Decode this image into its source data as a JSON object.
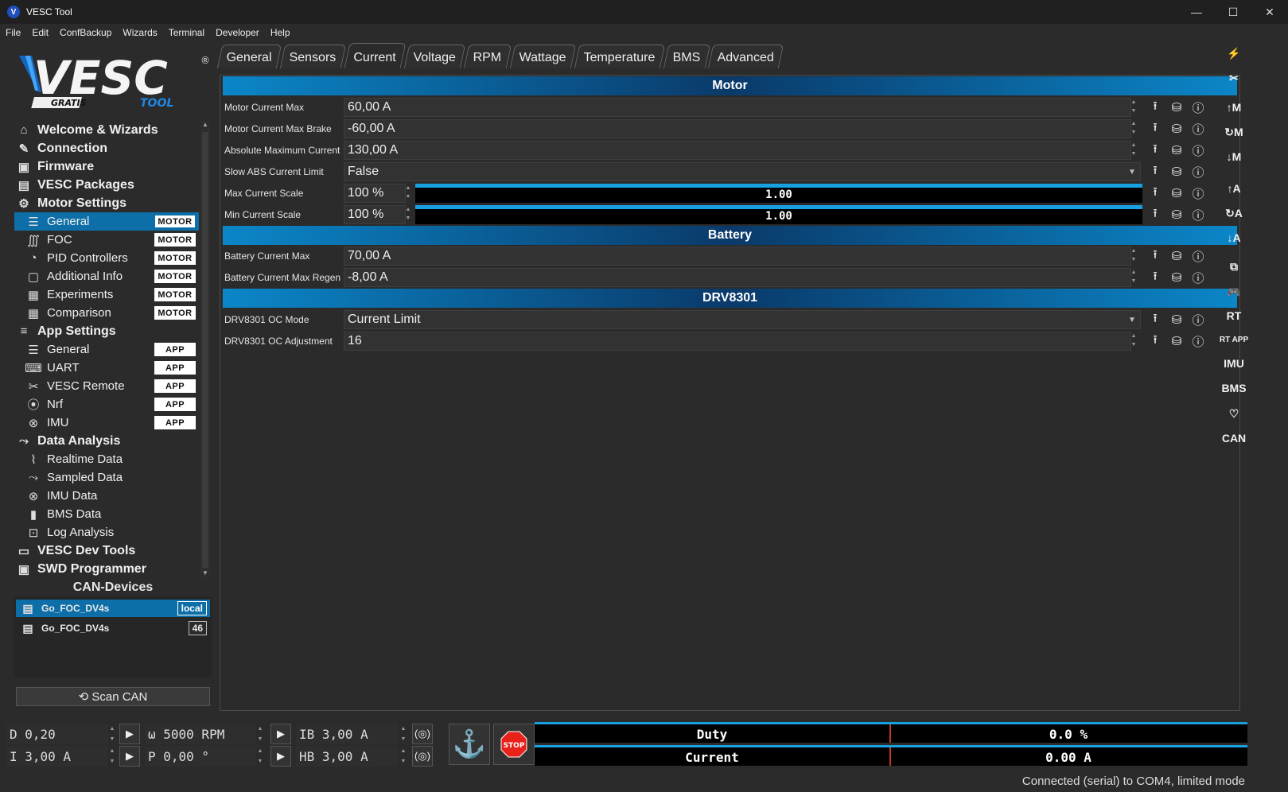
{
  "window": {
    "title": "VESC Tool",
    "controls": [
      "—",
      "☐",
      "✕"
    ]
  },
  "menu": [
    "File",
    "Edit",
    "ConfBackup",
    "Wizards",
    "Terminal",
    "Developer",
    "Help"
  ],
  "logo": {
    "main": "VESC",
    "sub1": "GRATIS",
    "sub2": "TOOL",
    "reg": "®"
  },
  "sidebar": {
    "items": [
      {
        "label": "Welcome & Wizards",
        "icon": "home-icon",
        "glyph": "⌂",
        "top": true
      },
      {
        "label": "Connection",
        "icon": "plug-icon",
        "glyph": "✎",
        "top": true
      },
      {
        "label": "Firmware",
        "icon": "chip-icon",
        "glyph": "▣",
        "top": true
      },
      {
        "label": "VESC Packages",
        "icon": "package-icon",
        "glyph": "▤",
        "top": true
      },
      {
        "label": "Motor Settings",
        "icon": "motor-icon",
        "glyph": "⚙",
        "top": true
      },
      {
        "label": "General",
        "icon": "sliders-icon",
        "glyph": "☰",
        "badge": "MOTOR",
        "selected": true
      },
      {
        "label": "FOC",
        "icon": "coil-icon",
        "glyph": "∭",
        "badge": "MOTOR"
      },
      {
        "label": "PID Controllers",
        "icon": "gauge-icon",
        "glyph": "◔",
        "badge": "MOTOR"
      },
      {
        "label": "Additional Info",
        "icon": "info-icon",
        "glyph": "▢",
        "badge": "MOTOR"
      },
      {
        "label": "Experiments",
        "icon": "calculator-icon",
        "glyph": "▦",
        "badge": "MOTOR"
      },
      {
        "label": "Comparison",
        "icon": "calculator-icon",
        "glyph": "▦",
        "badge": "MOTOR"
      },
      {
        "label": "App Settings",
        "icon": "app-sliders-icon",
        "glyph": "≡",
        "top": true
      },
      {
        "label": "General",
        "icon": "sliders-icon",
        "glyph": "☰",
        "badge": "APP"
      },
      {
        "label": "UART",
        "icon": "keyboard-icon",
        "glyph": "⌨",
        "badge": "APP"
      },
      {
        "label": "VESC Remote",
        "icon": "remote-icon",
        "glyph": "✂",
        "badge": "APP"
      },
      {
        "label": "Nrf",
        "icon": "radio-icon",
        "glyph": "⦿",
        "badge": "APP"
      },
      {
        "label": "IMU",
        "icon": "imu-icon",
        "glyph": "⊗",
        "badge": "APP"
      },
      {
        "label": "Data Analysis",
        "icon": "chart-icon",
        "glyph": "⤳",
        "top": true
      },
      {
        "label": "Realtime Data",
        "icon": "realtime-icon",
        "glyph": "⌇"
      },
      {
        "label": "Sampled Data",
        "icon": "sampled-icon",
        "glyph": "⤳"
      },
      {
        "label": "IMU Data",
        "icon": "imu-icon",
        "glyph": "⊗"
      },
      {
        "label": "BMS Data",
        "icon": "battery-icon",
        "glyph": "▮"
      },
      {
        "label": "Log Analysis",
        "icon": "log-icon",
        "glyph": "⊡"
      },
      {
        "label": "VESC Dev Tools",
        "icon": "terminal-icon",
        "glyph": "▭",
        "top": true
      },
      {
        "label": "SWD Programmer",
        "icon": "chip-icon",
        "glyph": "▣",
        "top": true
      }
    ]
  },
  "can": {
    "title": "CAN-Devices",
    "devices": [
      {
        "name": "Go_FOC_DV4s",
        "tag": "local",
        "selected": true
      },
      {
        "name": "Go_FOC_DV4s",
        "tag": "46",
        "selected": false
      }
    ],
    "scan_label": "⟲ Scan CAN"
  },
  "tabs": [
    "General",
    "Sensors",
    "Current",
    "Voltage",
    "RPM",
    "Wattage",
    "Temperature",
    "BMS",
    "Advanced"
  ],
  "active_tab": "Current",
  "sections": {
    "motor": "Motor",
    "battery": "Battery",
    "drv": "DRV8301"
  },
  "params": {
    "motor_current_max": {
      "label": "Motor Current Max",
      "value": "60,00 A"
    },
    "motor_current_max_brake": {
      "label": "Motor Current Max Brake",
      "value": "-60,00 A"
    },
    "abs_max_current": {
      "label": "Absolute Maximum Current",
      "value": "130,00 A"
    },
    "slow_abs": {
      "label": "Slow ABS Current Limit",
      "value": "False"
    },
    "max_current_scale": {
      "label": "Max Current Scale",
      "value": "100 %",
      "bar": "1.00",
      "fraction": 1.0
    },
    "min_current_scale": {
      "label": "Min Current Scale",
      "value": "100 %",
      "bar": "1.00",
      "fraction": 1.0
    },
    "battery_current_max": {
      "label": "Battery Current Max",
      "value": "70,00 A"
    },
    "battery_current_max_regen": {
      "label": "Battery Current Max Regen",
      "value": "-8,00 A"
    },
    "drv_oc_mode": {
      "label": "DRV8301 OC Mode",
      "value": "Current Limit"
    },
    "drv_oc_adj": {
      "label": "DRV8301 OC Adjustment",
      "value": "16"
    }
  },
  "rightbar": [
    "⚡",
    "✂",
    "↑M",
    "↻M",
    "↓M",
    "↑A",
    "↻A",
    "↓A",
    "⧉",
    "🎮",
    "RT",
    "RT APP",
    "IMU",
    "BMS",
    "♡",
    "CAN"
  ],
  "bottom": {
    "duty_input": "D 0,20",
    "rpm_input": "ω 5000 RPM",
    "ib_input": "IB 3,00 A",
    "current_input": "I 3,00 A",
    "pos_input": "P 0,00 °",
    "hb_input": "HB 3,00 A",
    "stop_label": "STOP",
    "duty_meter": {
      "label": "Duty",
      "value": "0.0 %"
    },
    "current_meter": {
      "label": "Current",
      "value": "0.00 A"
    }
  },
  "status": "Connected (serial) to COM4, limited mode",
  "colors": {
    "accent": "#0d6ea8",
    "bar": "#19a0e0",
    "stop": "#e8221a"
  }
}
